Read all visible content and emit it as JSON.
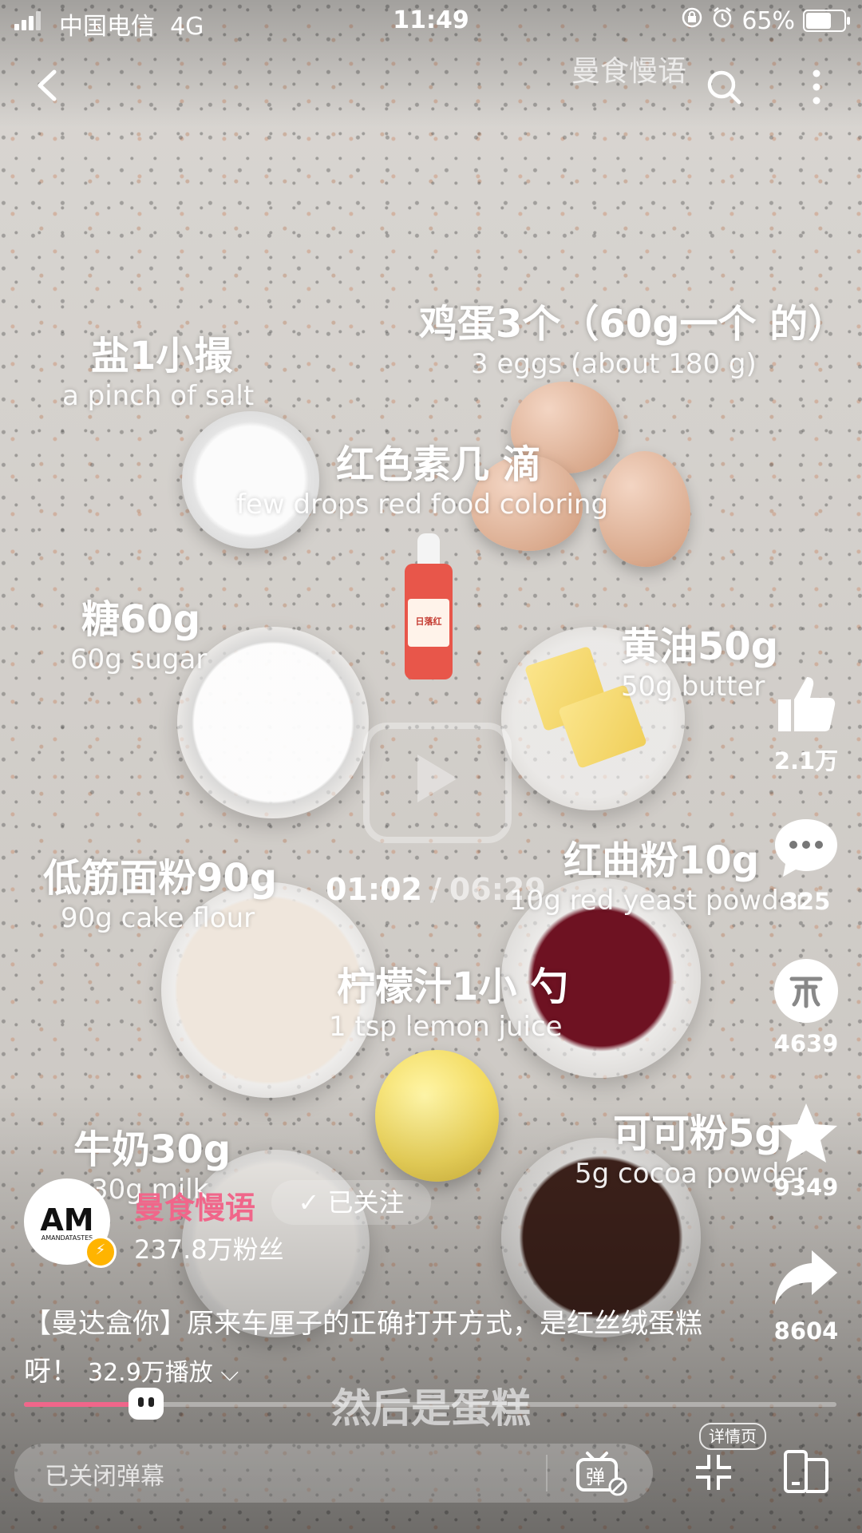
{
  "status_bar": {
    "carrier": "中国电信",
    "network": "4G",
    "time": "11:49",
    "battery": "65%",
    "battery_level": 0.65
  },
  "nav": {
    "watermark": "曼食慢语"
  },
  "labels": {
    "salt": {
      "zh": "盐1小撮",
      "en": "a pinch of salt"
    },
    "eggs": {
      "zh": "鸡蛋3个（60g一个 的）",
      "en": "3 eggs (about 180 g)"
    },
    "coloring": {
      "zh": "红色素几 滴",
      "en": "few drops red food coloring"
    },
    "sugar": {
      "zh": "糖60g",
      "en": "60g sugar"
    },
    "butter": {
      "zh": "黄油50g",
      "en": "50g butter"
    },
    "flour": {
      "zh": "低筋面粉90g",
      "en": "90g cake flour"
    },
    "yeast": {
      "zh": "红曲粉10g",
      "en": "10g red yeast powder"
    },
    "lemon": {
      "zh": "柠檬汁1小 勺",
      "en": "1 tsp lemon juice"
    },
    "milk": {
      "zh": "牛奶30g",
      "en": "30g milk"
    },
    "cocoa": {
      "zh": "可可粉5g",
      "en": "5g cocoa powder"
    }
  },
  "bottle_label": "日落红",
  "player": {
    "current": "01:02",
    "separator": "/",
    "total": "06:29",
    "progress": 0.133,
    "subtitle": "然后是蛋糕"
  },
  "actions": {
    "like": "2.1万",
    "comment": "325",
    "coin": "4639",
    "favorite": "9349",
    "share": "8604"
  },
  "author": {
    "avatar_text": "AM",
    "avatar_sub": "AMANDATASTES",
    "name": "曼食慢语",
    "follow": "已关注",
    "fans": "237.8万粉丝"
  },
  "description": {
    "title": "【曼达盒你】原来车厘子的正确打开方式，是红丝绒蛋糕呀！",
    "plays": "32.9万播放"
  },
  "bottom": {
    "danmaku_placeholder": "已关闭弹幕",
    "danmaku_toggle": "弹",
    "detail": "详情页"
  },
  "colors": {
    "accent": "#f0668a",
    "text": "#ffffff"
  }
}
